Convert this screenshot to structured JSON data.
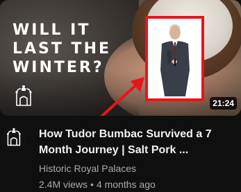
{
  "video": {
    "thumbnail": {
      "headline_lines": [
        "WILL IT",
        "LAST THE",
        "WINTER?"
      ],
      "duration": "21:24",
      "inset_outline_color": "#e8141c",
      "arrow_color": "#e8141c"
    },
    "title_lines": [
      "How Tudor Bumbac Survived a 7",
      "Month Journey | Salt Pork ..."
    ],
    "channel": {
      "name": "Historic Royal Palaces",
      "avatar_icon": "palace-crest-icon"
    },
    "views": "2.4M views",
    "separator": "•",
    "age": "4 months ago"
  }
}
